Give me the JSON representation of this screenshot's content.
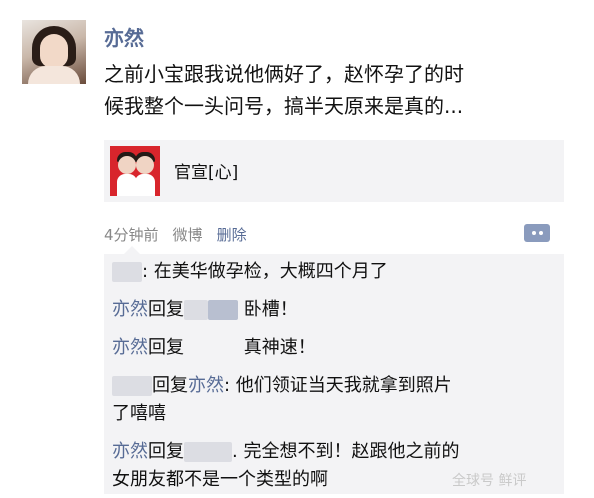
{
  "post": {
    "username": "亦然",
    "text_line1": "之前小宝跟我说他俩好了，赵怀孕了的时",
    "text_line2": "候我整个一头问号，搞半天原来是真的...",
    "share_title": "官宣[心]",
    "meta": {
      "time": "4分钟前",
      "source": "微博",
      "delete": "删除"
    }
  },
  "comments": [
    {
      "text": ": 在美华做孕检，大概四个月了"
    },
    {
      "name": "亦然",
      "reply": "回复",
      "text": " 卧槽！"
    },
    {
      "name": "亦然",
      "reply": "回复",
      "text": " 真神速！"
    },
    {
      "reply": "回复",
      "name2": "亦然",
      "text": ": 他们领证当天我就拿到照片",
      "text2": "了嘻嘻"
    },
    {
      "name": "亦然",
      "reply": "回复",
      "text": ". 完全想不到！赵跟他之前的",
      "text2": "女朋友都不是一个类型的啊"
    }
  ],
  "watermark": "全球号 鲜评",
  "colors": {
    "name_blue": "#576b95",
    "panel_bg": "#f3f3f5",
    "meta_gray": "#888888"
  }
}
